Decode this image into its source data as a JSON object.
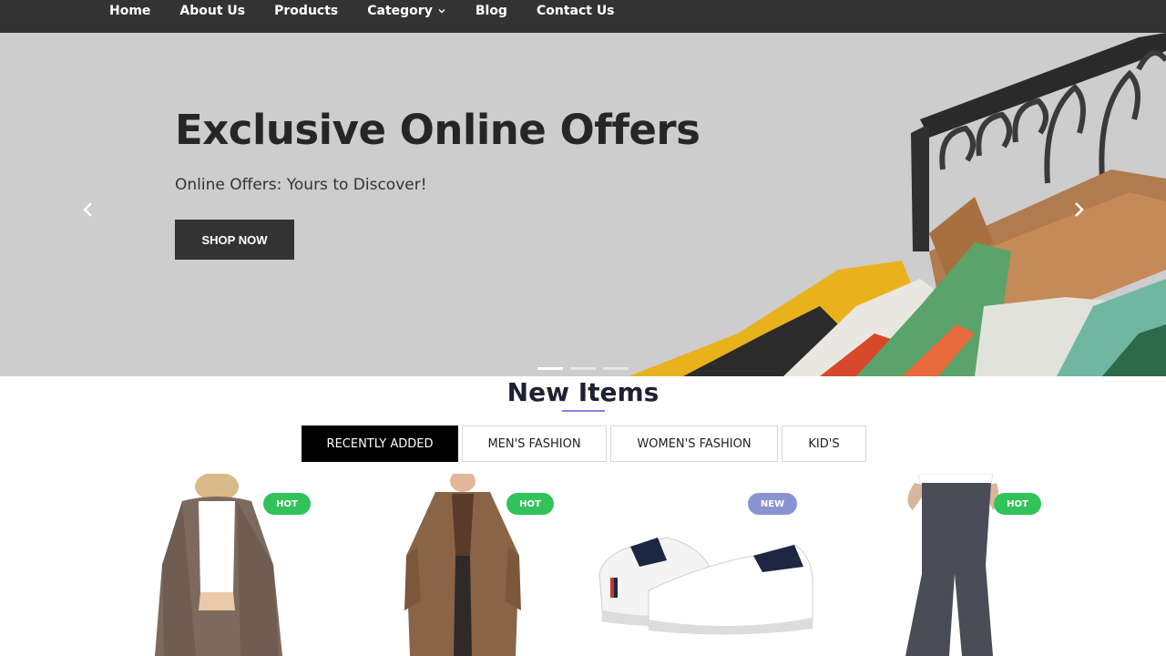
{
  "nav": {
    "items": [
      {
        "label": "Home"
      },
      {
        "label": "About Us"
      },
      {
        "label": "Products"
      },
      {
        "label": "Category"
      },
      {
        "label": "Blog"
      },
      {
        "label": "Contact Us"
      }
    ]
  },
  "hero": {
    "title": "Exclusive Online Offers",
    "subtitle": "Online Offers: Yours to Discover!",
    "button": "SHOP NOW",
    "prev_icon": "chevron-left-icon",
    "next_icon": "chevron-right-icon",
    "slides_total": 3,
    "active_slide": 1,
    "background_color": "#cdcdcd",
    "image": "clothes-on-hangers"
  },
  "new_items": {
    "title": "New Items",
    "tabs": [
      {
        "label": "RECENTLY ADDED",
        "active": true
      },
      {
        "label": "MEN'S FASHION",
        "active": false
      },
      {
        "label": "WOMEN'S FASHION",
        "active": false
      },
      {
        "label": "KID'S",
        "active": false
      }
    ],
    "products": [
      {
        "image": "brown-cardigan",
        "badge": "HOT"
      },
      {
        "image": "brown-trench-coat",
        "badge": "HOT"
      },
      {
        "image": "white-sneakers",
        "badge": "NEW"
      },
      {
        "image": "grey-flare-pants",
        "badge": "HOT"
      }
    ]
  },
  "colors": {
    "nav_bg": "#333333",
    "accent_underline": "#9b7be0",
    "badge_hot": "#31c25a",
    "badge_new": "#8a93d2",
    "tab_active": "#000000"
  }
}
